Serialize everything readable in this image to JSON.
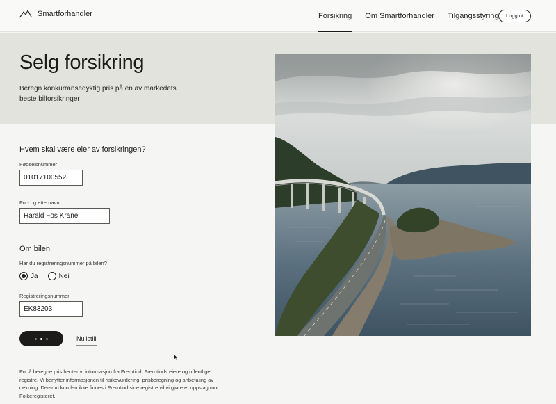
{
  "header": {
    "brand": "Smartforhandler",
    "logo_icon": "mountain-icon",
    "nav": [
      {
        "label": "Forsikring",
        "active": true
      },
      {
        "label": "Om Smartforhandler",
        "active": false
      },
      {
        "label": "Tilgangsstyring",
        "active": false
      }
    ],
    "logout_label": "Logg ut"
  },
  "hero": {
    "title": "Selg forsikring",
    "subtitle": "Beregn konkurransedyktig pris på en av markedets beste bilforsikringer"
  },
  "owner": {
    "heading": "Hvem skal være eier av forsikringen?",
    "ssn_label": "Fødselsnummer",
    "ssn_value": "01017100552",
    "name_label": "For- og etternavn",
    "name_value": "Harald Fos Krane"
  },
  "car": {
    "heading": "Om bilen",
    "question": "Har du registreringsnummer på bilen?",
    "options": [
      "Ja",
      "Nei"
    ],
    "selected": "Ja",
    "reg_label": "Registreringsnummer",
    "reg_value": "EK83203"
  },
  "actions": {
    "submit_state": "loading",
    "reset_label": "Nullstill"
  },
  "disclaimer": "For å beregne pris henter vi informasjon fra Fremtind, Fremtinds eiere og offentlige registre. Vi benytter informasjonen til risikovurdering, prisberegning og anbefaling av dekning. Dersom kunden ikke finnes i Fremtind sine registre vil vi gjøre et oppslag mot Folkeregisteret.",
  "colors": {
    "hero_band": "#e3e3dd",
    "primary": "#1c1b1a",
    "background": "#f5f5f3"
  }
}
